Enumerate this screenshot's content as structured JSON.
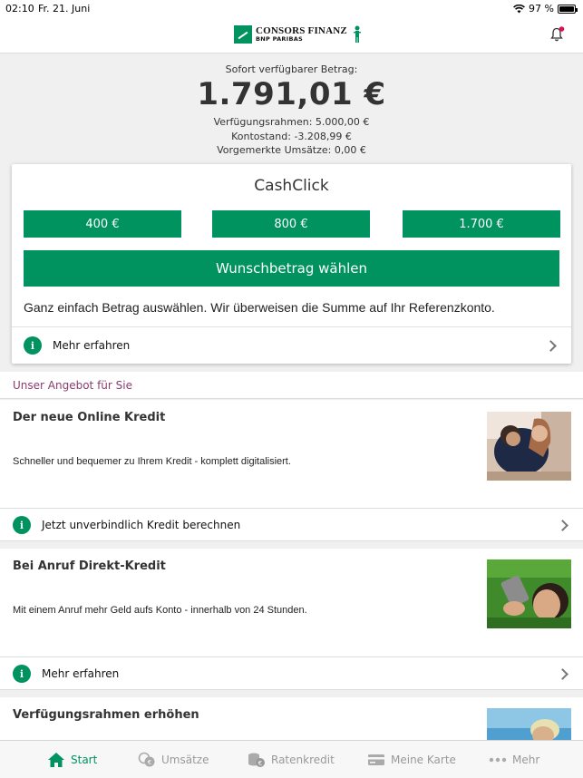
{
  "status": {
    "time": "02:10",
    "date": "Fr. 21. Juni",
    "battery": "97 %",
    "battery_level": 0.97
  },
  "header": {
    "brand_line1": "CONSORS FINANZ",
    "brand_line2": "BNP PARIBAS"
  },
  "summary": {
    "label": "Sofort verfügbarer Betrag:",
    "amount": "1.791,01 €",
    "credit_line": "Verfügungsrahmen: 5.000,00 €",
    "balance": "Kontostand: -3.208,99 €",
    "pending": "Vorgemerkte Umsätze: 0,00 €"
  },
  "cashclick": {
    "title": "CashClick",
    "amounts": [
      "400 €",
      "800 €",
      "1.700 €"
    ],
    "wish_label": "Wunschbetrag wählen",
    "description": "Ganz einfach Betrag auswählen. Wir überweisen die Summe auf Ihr Referenzkonto.",
    "more_label": "Mehr erfahren"
  },
  "offers": {
    "heading": "Unser Angebot für Sie",
    "items": [
      {
        "title": "Der neue Online Kredit",
        "text": "Schneller und bequemer zu Ihrem Kredit - komplett digitalisiert.",
        "link": "Jetzt unverbindlich Kredit berechnen"
      },
      {
        "title": "Bei Anruf Direkt-Kredit",
        "text": "Mit einem Anruf mehr Geld aufs Konto - innerhalb von 24 Stunden.",
        "link": "Mehr erfahren"
      },
      {
        "title": "Verfügungsrahmen erhöhen"
      }
    ]
  },
  "tabs": {
    "start": "Start",
    "umsaetze": "Umsätze",
    "ratenkredit": "Ratenkredit",
    "karte": "Meine Karte",
    "mehr": "Mehr"
  },
  "colors": {
    "brand_green": "#00935f",
    "offer_heading": "#8a3d6f"
  }
}
